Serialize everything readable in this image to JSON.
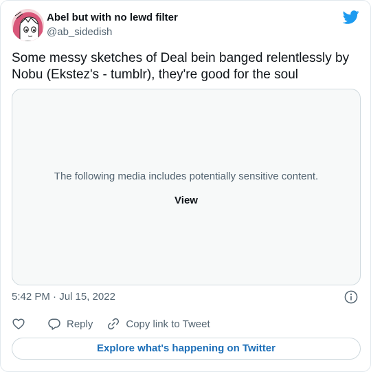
{
  "author": {
    "display_name": "Abel but with no lewd filter",
    "handle": "@ab_sidedish"
  },
  "tweet": {
    "text": "Some messy sketches of Deal bein banged relentlessly by Nobu (Ekstez's - tumblr), they're good for the soul",
    "timestamp": "5:42 PM · Jul 15, 2022"
  },
  "media": {
    "warning": "The following media includes potentially sensitive content.",
    "view_label": "View"
  },
  "actions": {
    "reply_label": "Reply",
    "copy_link_label": "Copy link to Tweet"
  },
  "explore_label": "Explore what's happening on Twitter",
  "icons": {
    "logo": "twitter-bird-icon",
    "info": "info-icon",
    "like": "heart-icon",
    "reply": "reply-bubble-icon",
    "copy": "link-icon"
  },
  "colors": {
    "brand_blue": "#1d9bf0",
    "link_blue": "#1d6fb8",
    "secondary_text": "#536471",
    "border": "#cfd9de",
    "media_bg": "#f7f9f9"
  }
}
